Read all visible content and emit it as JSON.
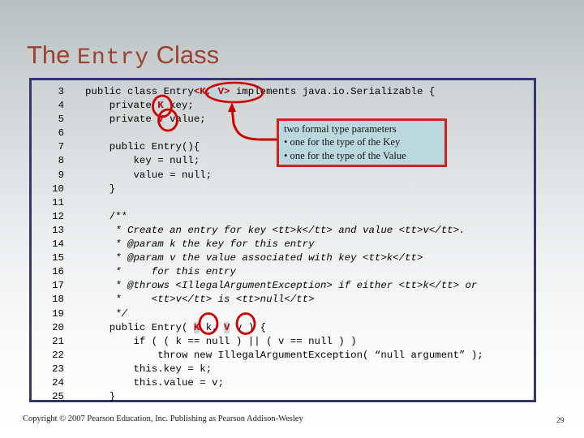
{
  "slide": {
    "title_prefix": "The ",
    "title_mono": "Entry",
    "title_suffix": " Class",
    "title_color": "#9b4230",
    "border_color": "#35356f",
    "highlight_color": "#bcd8de",
    "annotation_color": "#cc0000",
    "callout_border_color": "#d42020",
    "callout_bg_color": "#b9d9de"
  },
  "code": {
    "lines": [
      {
        "no": "3",
        "pre": "public class Entry",
        "hl": "<K, V>",
        "post": " implements java.io.Serializable {",
        "italic": false
      },
      {
        "no": "4",
        "pre": "    private ",
        "hl": "K",
        "post": " key;",
        "italic": false
      },
      {
        "no": "5",
        "pre": "    private ",
        "hl": "V",
        "post": " value;",
        "italic": false
      },
      {
        "no": "6",
        "pre": "",
        "hl": "",
        "post": "",
        "italic": false
      },
      {
        "no": "7",
        "pre": "    public Entry(){",
        "hl": "",
        "post": "",
        "italic": false
      },
      {
        "no": "8",
        "pre": "        key = null;",
        "hl": "",
        "post": "",
        "italic": false
      },
      {
        "no": "9",
        "pre": "        value = null;",
        "hl": "",
        "post": "",
        "italic": false
      },
      {
        "no": "10",
        "pre": "    }",
        "hl": "",
        "post": "",
        "italic": false
      },
      {
        "no": "11",
        "pre": "",
        "hl": "",
        "post": "",
        "italic": false
      },
      {
        "no": "12",
        "pre": "    /**",
        "hl": "",
        "post": "",
        "italic": false
      },
      {
        "no": "13",
        "pre": "     * Create an entry for key <tt>k</tt> and value <tt>v</tt>.",
        "hl": "",
        "post": "",
        "italic": true
      },
      {
        "no": "14",
        "pre": "     * @param k the key for this entry",
        "hl": "",
        "post": "",
        "italic": true
      },
      {
        "no": "15",
        "pre": "     * @param v the value associated with key <tt>k</tt>",
        "hl": "",
        "post": "",
        "italic": true
      },
      {
        "no": "16",
        "pre": "     *     for this entry",
        "hl": "",
        "post": "",
        "italic": true
      },
      {
        "no": "17",
        "pre": "     * @throws <IllegalArgumentException> if either <tt>k</tt> or",
        "hl": "",
        "post": "",
        "italic": true
      },
      {
        "no": "18",
        "pre": "     *     <tt>v</tt> is <tt>null</tt>",
        "hl": "",
        "post": "",
        "italic": true
      },
      {
        "no": "19",
        "pre": "     */",
        "hl": "",
        "post": "",
        "italic": true
      },
      {
        "no": "20",
        "pre": "    public Entry( ",
        "hl": "K",
        "post": " k, ",
        "hl2": "V",
        "post2": " v ) {",
        "italic": false
      },
      {
        "no": "21",
        "pre": "        if ( ( k == null ) || ( v == null ) )",
        "hl": "",
        "post": "",
        "italic": false
      },
      {
        "no": "22",
        "pre": "            throw new IllegalArgumentException( “null argument” );",
        "hl": "",
        "post": "",
        "italic": false
      },
      {
        "no": "23",
        "pre": "        this.key = k;",
        "hl": "",
        "post": "",
        "italic": false
      },
      {
        "no": "24",
        "pre": "        this.value = v;",
        "hl": "",
        "post": "",
        "italic": false
      },
      {
        "no": "25",
        "pre": "    }",
        "hl": "",
        "post": "",
        "italic": false
      }
    ]
  },
  "callout": {
    "heading": "two formal type parameters",
    "bullets": [
      "• one for the type of the Key",
      "• one for the type of the Value"
    ]
  },
  "footer": {
    "copyright": "Copyright © 2007 Pearson Education, Inc. Publishing as Pearson Addison-Wesley",
    "page_number": "29"
  }
}
